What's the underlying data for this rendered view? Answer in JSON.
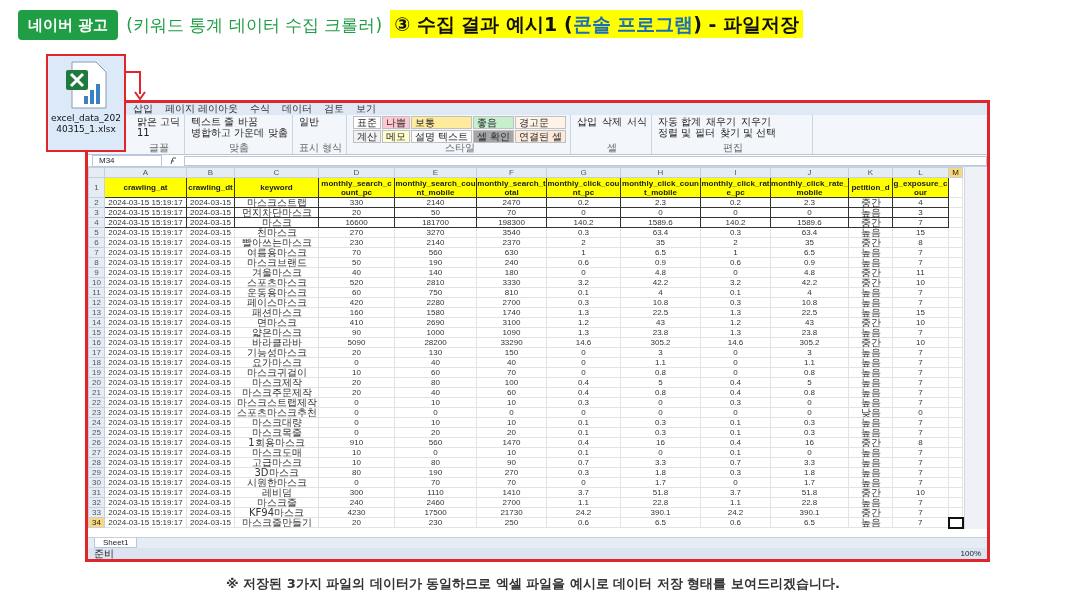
{
  "badge": "네이버 광고",
  "subtitle": "(키워드 통계 데이터 수집 크롤러)",
  "heading": [
    {
      "text": "③ 수집 결과 예시1 (",
      "accent": false
    },
    {
      "text": "콘솔 프로그램",
      "accent": true
    },
    {
      "text": ") - 파일저장",
      "accent": false
    }
  ],
  "file_icon": {
    "label": "excel_data_20240315_1.xlsx"
  },
  "excel": {
    "ribbon_tabs": [
      "삽입",
      "페이지 레이아웃",
      "수식",
      "데이터",
      "검토",
      "보기"
    ],
    "ribbon_groups": [
      {
        "label": "글꼴",
        "kind": "items",
        "items": [
          "맑은 고딕",
          "11"
        ]
      },
      {
        "label": "맞춤",
        "kind": "items",
        "items": [
          "텍스트 줄 바꿈",
          "병합하고 가운데 맞춤"
        ]
      },
      {
        "label": "표시 형식",
        "kind": "items",
        "items": [
          "일반"
        ]
      },
      {
        "label": "스타일",
        "kind": "styles",
        "styles": [
          {
            "text": "표준",
            "color": "#ffffff"
          },
          {
            "text": "나쁨",
            "color": "#ffc7ce"
          },
          {
            "text": "보통",
            "color": "#ffeb9c"
          },
          {
            "text": "좋음",
            "color": "#c6efce"
          },
          {
            "text": "경고문",
            "color": "#fff2e6"
          },
          {
            "text": "계산",
            "color": "#f2f2f2"
          },
          {
            "text": "메모",
            "color": "#ffffcc"
          },
          {
            "text": "설명 텍스트",
            "color": "#fafafa"
          },
          {
            "text": "셀 확인",
            "color": "#a5a5a5"
          },
          {
            "text": "연결된 셀",
            "color": "#fde9d9"
          }
        ]
      },
      {
        "label": "셀",
        "kind": "items",
        "items": [
          "삽입",
          "삭제",
          "서식"
        ]
      },
      {
        "label": "편집",
        "kind": "items",
        "items": [
          "자동 합계",
          "채우기",
          "지우기",
          "정렬 및 필터",
          "찾기 및 선택"
        ]
      }
    ],
    "name_box": "M34",
    "columns": [
      {
        "letter": "A",
        "selected": false
      },
      {
        "letter": "B",
        "selected": false
      },
      {
        "letter": "C",
        "selected": false
      },
      {
        "letter": "D",
        "selected": false
      },
      {
        "letter": "E",
        "selected": false
      },
      {
        "letter": "F",
        "selected": false
      },
      {
        "letter": "G",
        "selected": false
      },
      {
        "letter": "H",
        "selected": false
      },
      {
        "letter": "I",
        "selected": false
      },
      {
        "letter": "J",
        "selected": false
      },
      {
        "letter": "K",
        "selected": false
      },
      {
        "letter": "L",
        "selected": false
      },
      {
        "letter": "M",
        "selected": true
      }
    ],
    "rows": [
      {
        "num": "1",
        "kind": "header",
        "bordered": true,
        "selected": false,
        "cells": [
          "crawling_at",
          "crawling_dt",
          "keyword",
          "monthly_search_count_pc",
          "monthly_search_count_mobile",
          "monthly_search_total",
          "monthly_click_count_pc",
          "monthly_click_count_mobile",
          "monthly_click_rate_pc",
          "monthly_click_rate_mobile",
          "petition_d",
          "g_exposure_cour"
        ]
      },
      {
        "num": "2",
        "kind": "data",
        "bordered": true,
        "selected": false,
        "cells": [
          "2024-03-15 15:19:17",
          "2024-03-15",
          "마스크스트랩",
          "330",
          "2140",
          "2470",
          "0.2",
          "2.3",
          "0.2",
          "2.3",
          "중간",
          "4"
        ]
      },
      {
        "num": "3",
        "kind": "data",
        "bordered": true,
        "selected": false,
        "cells": [
          "2024-03-15 15:19:17",
          "2024-03-15",
          "먼지차단마스크",
          "20",
          "50",
          "70",
          "0",
          "0",
          "0",
          "0",
          "높음",
          "3"
        ]
      },
      {
        "num": "4",
        "kind": "data",
        "bordered": true,
        "selected": false,
        "cells": [
          "2024-03-15 15:19:17",
          "2024-03-15",
          "마스크",
          "16600",
          "181700",
          "198300",
          "140.2",
          "1589.6",
          "140.2",
          "1589.6",
          "중간",
          "7"
        ]
      },
      {
        "num": "5",
        "kind": "data",
        "bordered": false,
        "selected": false,
        "cells": [
          "2024-03-15 15:19:17",
          "2024-03-15",
          "천마스크",
          "270",
          "3270",
          "3540",
          "0.3",
          "63.4",
          "0.3",
          "63.4",
          "높음",
          "15"
        ]
      },
      {
        "num": "6",
        "kind": "data",
        "bordered": false,
        "selected": false,
        "cells": [
          "2024-03-15 15:19:17",
          "2024-03-15",
          "빨아쓰는마스크",
          "230",
          "2140",
          "2370",
          "2",
          "35",
          "2",
          "35",
          "중간",
          "8"
        ]
      },
      {
        "num": "7",
        "kind": "data",
        "bordered": false,
        "selected": false,
        "cells": [
          "2024-03-15 15:19:17",
          "2024-03-15",
          "여름용마스크",
          "70",
          "560",
          "630",
          "1",
          "6.5",
          "1",
          "6.5",
          "높음",
          "7"
        ]
      },
      {
        "num": "8",
        "kind": "data",
        "bordered": false,
        "selected": false,
        "cells": [
          "2024-03-15 15:19:17",
          "2024-03-15",
          "마스크브랜드",
          "50",
          "190",
          "240",
          "0.6",
          "0.9",
          "0.6",
          "0.9",
          "높음",
          "7"
        ]
      },
      {
        "num": "9",
        "kind": "data",
        "bordered": false,
        "selected": false,
        "cells": [
          "2024-03-15 15:19:17",
          "2024-03-15",
          "겨울마스크",
          "40",
          "140",
          "180",
          "0",
          "4.8",
          "0",
          "4.8",
          "중간",
          "11"
        ]
      },
      {
        "num": "10",
        "kind": "data",
        "bordered": false,
        "selected": false,
        "cells": [
          "2024-03-15 15:19:17",
          "2024-03-15",
          "스포츠마스크",
          "520",
          "2810",
          "3330",
          "3.2",
          "42.2",
          "3.2",
          "42.2",
          "중간",
          "10"
        ]
      },
      {
        "num": "11",
        "kind": "data",
        "bordered": false,
        "selected": false,
        "cells": [
          "2024-03-15 15:19:17",
          "2024-03-15",
          "운동용마스크",
          "60",
          "750",
          "810",
          "0.1",
          "4",
          "0.1",
          "4",
          "높음",
          "7"
        ]
      },
      {
        "num": "12",
        "kind": "data",
        "bordered": false,
        "selected": false,
        "cells": [
          "2024-03-15 15:19:17",
          "2024-03-15",
          "페이스마스크",
          "420",
          "2280",
          "2700",
          "0.3",
          "10.8",
          "0.3",
          "10.8",
          "높음",
          "7"
        ]
      },
      {
        "num": "13",
        "kind": "data",
        "bordered": false,
        "selected": false,
        "cells": [
          "2024-03-15 15:19:17",
          "2024-03-15",
          "패션마스크",
          "160",
          "1580",
          "1740",
          "1.3",
          "22.5",
          "1.3",
          "22.5",
          "높음",
          "15"
        ]
      },
      {
        "num": "14",
        "kind": "data",
        "bordered": false,
        "selected": false,
        "cells": [
          "2024-03-15 15:19:17",
          "2024-03-15",
          "면마스크",
          "410",
          "2690",
          "3100",
          "1.2",
          "43",
          "1.2",
          "43",
          "중간",
          "10"
        ]
      },
      {
        "num": "15",
        "kind": "data",
        "bordered": false,
        "selected": false,
        "cells": [
          "2024-03-15 15:19:17",
          "2024-03-15",
          "얇은마스크",
          "90",
          "1000",
          "1090",
          "1.3",
          "23.8",
          "1.3",
          "23.8",
          "높음",
          "7"
        ]
      },
      {
        "num": "16",
        "kind": "data",
        "bordered": false,
        "selected": false,
        "cells": [
          "2024-03-15 15:19:17",
          "2024-03-15",
          "바라클라바",
          "5090",
          "28200",
          "33290",
          "14.6",
          "305.2",
          "14.6",
          "305.2",
          "중간",
          "10"
        ]
      },
      {
        "num": "17",
        "kind": "data",
        "bordered": false,
        "selected": false,
        "cells": [
          "2024-03-15 15:19:17",
          "2024-03-15",
          "기능성마스크",
          "20",
          "130",
          "150",
          "0",
          "3",
          "0",
          "3",
          "높음",
          "7"
        ]
      },
      {
        "num": "18",
        "kind": "data",
        "bordered": false,
        "selected": false,
        "cells": [
          "2024-03-15 15:19:17",
          "2024-03-15",
          "요가마스크",
          "0",
          "40",
          "40",
          "0",
          "1.1",
          "0",
          "1.1",
          "높음",
          "7"
        ]
      },
      {
        "num": "19",
        "kind": "data",
        "bordered": false,
        "selected": false,
        "cells": [
          "2024-03-15 15:19:17",
          "2024-03-15",
          "마스크귀걸이",
          "10",
          "60",
          "70",
          "0",
          "0.8",
          "0",
          "0.8",
          "높음",
          "7"
        ]
      },
      {
        "num": "20",
        "kind": "data",
        "bordered": false,
        "selected": false,
        "cells": [
          "2024-03-15 15:19:17",
          "2024-03-15",
          "마스크제작",
          "20",
          "80",
          "100",
          "0.4",
          "5",
          "0.4",
          "5",
          "높음",
          "7"
        ]
      },
      {
        "num": "21",
        "kind": "data",
        "bordered": false,
        "selected": false,
        "cells": [
          "2024-03-15 15:19:17",
          "2024-03-15",
          "마스크주문제작",
          "20",
          "40",
          "60",
          "0.4",
          "0.8",
          "0.4",
          "0.8",
          "높음",
          "7"
        ]
      },
      {
        "num": "22",
        "kind": "data",
        "bordered": false,
        "selected": false,
        "cells": [
          "2024-03-15 15:19:17",
          "2024-03-15",
          "마스크스트랩제작",
          "0",
          "10",
          "10",
          "0.3",
          "0",
          "0.3",
          "0",
          "높음",
          "7"
        ]
      },
      {
        "num": "23",
        "kind": "data",
        "bordered": false,
        "selected": false,
        "cells": [
          "2024-03-15 15:19:17",
          "2024-03-15",
          "스포츠마스크추천",
          "0",
          "0",
          "0",
          "0",
          "0",
          "0",
          "0",
          "낮음",
          "0"
        ]
      },
      {
        "num": "24",
        "kind": "data",
        "bordered": false,
        "selected": false,
        "cells": [
          "2024-03-15 15:19:17",
          "2024-03-15",
          "마스크대량",
          "0",
          "10",
          "10",
          "0.1",
          "0.3",
          "0.1",
          "0.3",
          "높음",
          "7"
        ]
      },
      {
        "num": "25",
        "kind": "data",
        "bordered": false,
        "selected": false,
        "cells": [
          "2024-03-15 15:19:17",
          "2024-03-15",
          "마스크목줄",
          "0",
          "20",
          "20",
          "0.1",
          "0.3",
          "0.1",
          "0.3",
          "높음",
          "7"
        ]
      },
      {
        "num": "26",
        "kind": "data",
        "bordered": false,
        "selected": false,
        "cells": [
          "2024-03-15 15:19:17",
          "2024-03-15",
          "1회용마스크",
          "910",
          "560",
          "1470",
          "0.4",
          "16",
          "0.4",
          "16",
          "중간",
          "8"
        ]
      },
      {
        "num": "27",
        "kind": "data",
        "bordered": false,
        "selected": false,
        "cells": [
          "2024-03-15 15:19:17",
          "2024-03-15",
          "마스크도매",
          "10",
          "0",
          "10",
          "0.1",
          "0",
          "0.1",
          "0",
          "높음",
          "7"
        ]
      },
      {
        "num": "28",
        "kind": "data",
        "bordered": false,
        "selected": false,
        "cells": [
          "2024-03-15 15:19:17",
          "2024-03-15",
          "고급마스크",
          "10",
          "80",
          "90",
          "0.7",
          "3.3",
          "0.7",
          "3.3",
          "높음",
          "7"
        ]
      },
      {
        "num": "29",
        "kind": "data",
        "bordered": false,
        "selected": false,
        "cells": [
          "2024-03-15 15:19:17",
          "2024-03-15",
          "3D마스크",
          "80",
          "190",
          "270",
          "0.3",
          "1.8",
          "0.3",
          "1.8",
          "높음",
          "7"
        ]
      },
      {
        "num": "30",
        "kind": "data",
        "bordered": false,
        "selected": false,
        "cells": [
          "2024-03-15 15:19:17",
          "2024-03-15",
          "시원한마스크",
          "0",
          "70",
          "70",
          "0",
          "1.7",
          "0",
          "1.7",
          "높음",
          "7"
        ]
      },
      {
        "num": "31",
        "kind": "data",
        "bordered": false,
        "selected": false,
        "cells": [
          "2024-03-15 15:19:17",
          "2024-03-15",
          "레비덤",
          "300",
          "1110",
          "1410",
          "3.7",
          "51.8",
          "3.7",
          "51.8",
          "중간",
          "10"
        ]
      },
      {
        "num": "32",
        "kind": "data",
        "bordered": false,
        "selected": false,
        "cells": [
          "2024-03-15 15:19:17",
          "2024-03-15",
          "마스크줄",
          "240",
          "2460",
          "2700",
          "1.1",
          "22.8",
          "1.1",
          "22.8",
          "높음",
          "7"
        ]
      },
      {
        "num": "33",
        "kind": "data",
        "bordered": false,
        "selected": false,
        "cells": [
          "2024-03-15 15:19:17",
          "2024-03-15",
          "KF94마스크",
          "4230",
          "17500",
          "21730",
          "24.2",
          "390.1",
          "24.2",
          "390.1",
          "중간",
          "7"
        ]
      },
      {
        "num": "34",
        "kind": "data",
        "bordered": false,
        "selected": true,
        "cells": [
          "2024-03-15 15:19:17",
          "2024-03-15",
          "마스크줄만들기",
          "20",
          "230",
          "250",
          "0.6",
          "6.5",
          "0.6",
          "6.5",
          "높음",
          "7"
        ]
      }
    ],
    "sheet_tab": "Sheet1",
    "status": "준비",
    "zoom": "100%"
  },
  "caption": "※ 저장된 3가지 파일의 데이터가 동일하므로 엑셀 파일을 예시로 데이터 저장 형태를 보여드리겠습니다."
}
